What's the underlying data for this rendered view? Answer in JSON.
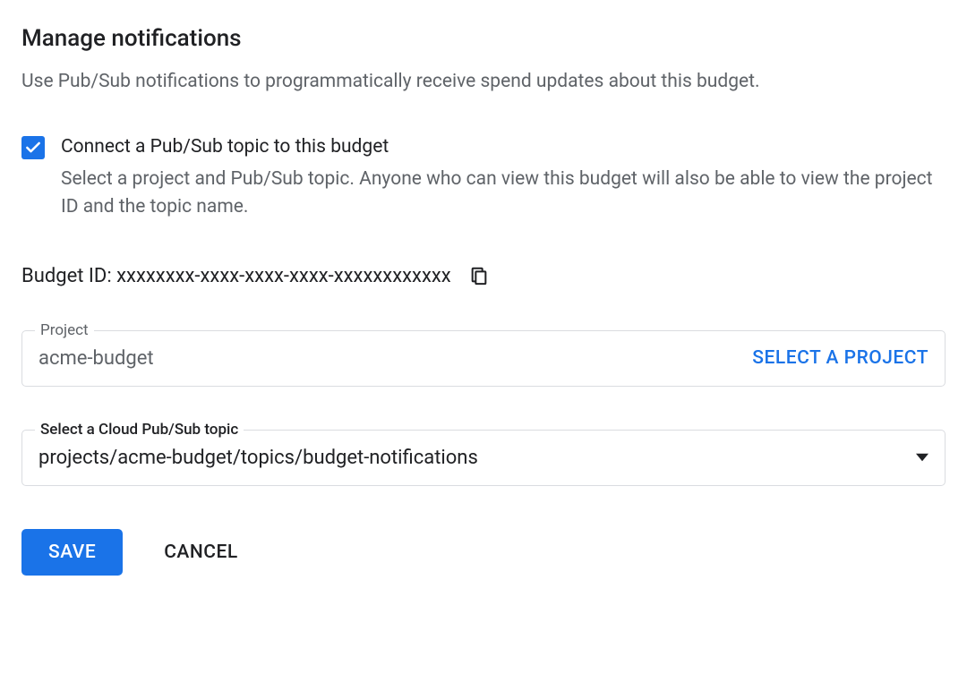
{
  "heading": "Manage notifications",
  "description": "Use Pub/Sub notifications to programmatically receive spend updates about this budget.",
  "checkbox": {
    "checked": true,
    "label": "Connect a Pub/Sub topic to this budget",
    "description": "Select a project and Pub/Sub topic. Anyone who can view this budget will also be able to view the project ID and the topic name."
  },
  "budgetId": {
    "text": "Budget ID: xxxxxxxx-xxxx-xxxx-xxxx-xxxxxxxxxxxx"
  },
  "projectField": {
    "label": "Project",
    "value": "acme-budget",
    "selectButton": "SELECT A PROJECT"
  },
  "topicField": {
    "label": "Select a Cloud Pub/Sub topic",
    "value": "projects/acme-budget/topics/budget-notifications"
  },
  "buttons": {
    "save": "SAVE",
    "cancel": "CANCEL"
  }
}
